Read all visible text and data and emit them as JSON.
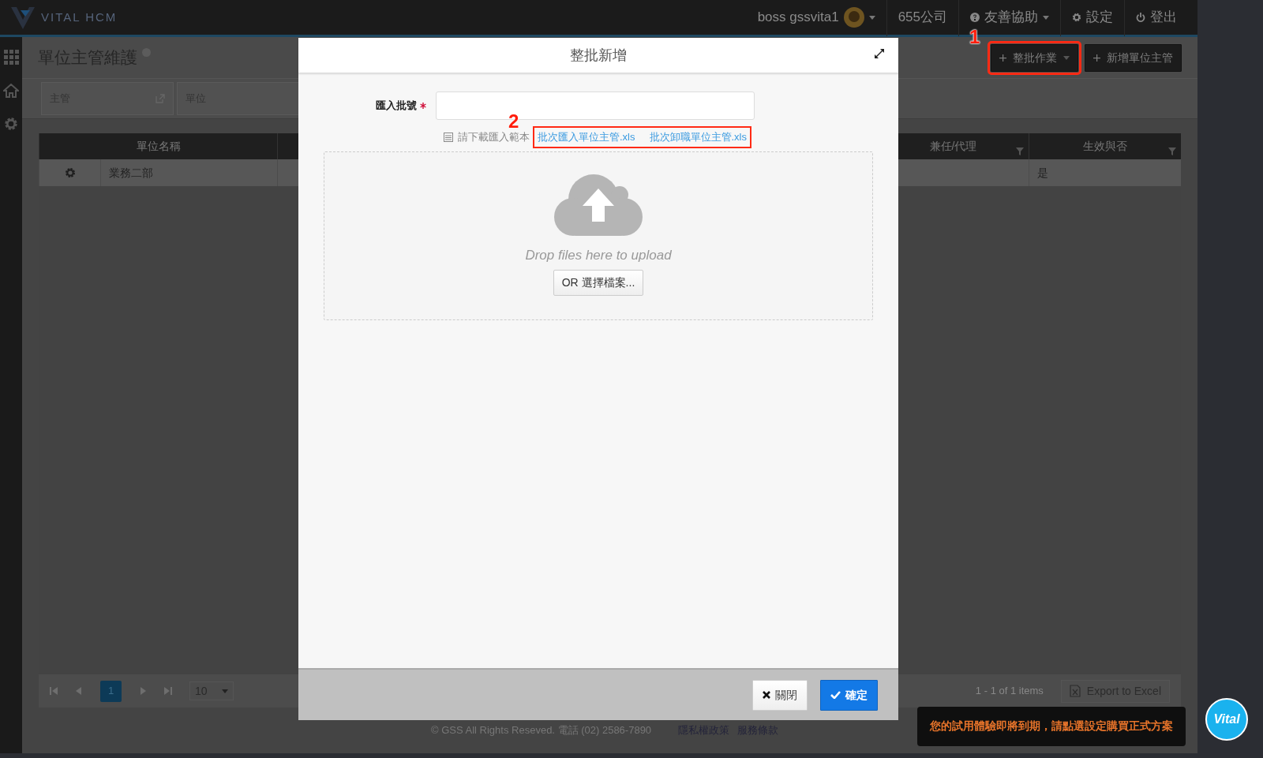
{
  "navbar": {
    "logo_text": "VITAL HCM",
    "user": "boss gssvita1",
    "company": "655公司",
    "help": "友善協助",
    "settings": "設定",
    "logout": "登出"
  },
  "sidebar": {
    "items": [
      {
        "kind": "apps"
      },
      {
        "kind": "home"
      },
      {
        "kind": "settings"
      }
    ]
  },
  "page": {
    "title": "單位主管維護",
    "buttons": [
      {
        "label": "整批作業",
        "kind": "dropdown",
        "annotation": "1"
      },
      {
        "label": "新增單位主管",
        "kind": "plain"
      }
    ],
    "filters": [
      {
        "label": "主管",
        "kind": "picker"
      },
      {
        "label": "單位",
        "kind": "text"
      }
    ]
  },
  "table": {
    "columns": [
      {
        "label": "單位名稱",
        "filter": false
      },
      {
        "label": "兼任/代理",
        "filter": true
      },
      {
        "label": "生效與否",
        "filter": true
      }
    ],
    "rows": [
      {
        "cells": [
          "業務二部",
          "",
          "是"
        ]
      }
    ]
  },
  "pager": {
    "pages": [
      {
        "label": "1",
        "selected": true
      }
    ],
    "page_size": "10",
    "summary": "1 - 1 of 1 items",
    "export": "Export to Excel"
  },
  "footer": {
    "copyright": "© GSS All Rights Reseved. 電話 (02) 2586-7890",
    "links": [
      "隱私權政策",
      "服務條款"
    ]
  },
  "modal": {
    "title": "整批新增",
    "field": {
      "label": "匯入批號",
      "required": true
    },
    "template_prompt": "請下載匯入範本",
    "templates_annotation": "2",
    "templates": [
      "批次匯入單位主管.xls",
      "批次卸職單位主管.xls"
    ],
    "dropzone": {
      "message": "Drop files here to upload",
      "button": "OR 選擇檔案..."
    },
    "buttons": [
      {
        "label": "關閉",
        "kind": "close"
      },
      {
        "label": "確定",
        "kind": "confirm"
      }
    ]
  },
  "toast": "您的試用體驗即將到期，請點選設定購買正式方案",
  "chat_badge": "Vital"
}
